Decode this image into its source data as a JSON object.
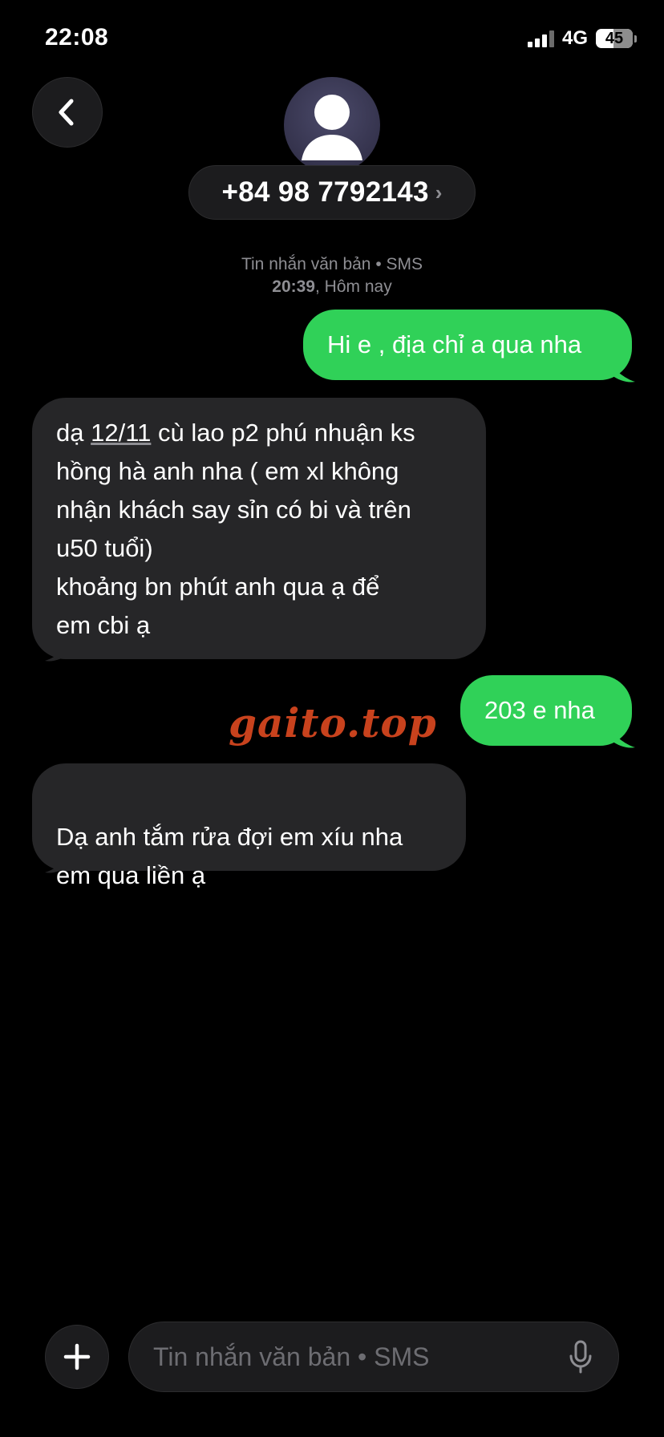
{
  "status_bar": {
    "time": "22:08",
    "network": "4G",
    "battery": "45"
  },
  "header": {
    "contact": "+84 98 7792143",
    "chevron": "›"
  },
  "thread": {
    "service_label": "Tin nhắn văn bản • SMS",
    "timestamp_time": "20:39",
    "timestamp_day": ", Hôm nay"
  },
  "messages": [
    {
      "direction": "outgoing",
      "text": "Hi e , địa chỉ a qua nha"
    },
    {
      "direction": "incoming",
      "text_before": "dạ ",
      "date_link": "12/11",
      "text_after": " cù lao p2 phú nhuận ks\nhồng hà anh nha  (  em xl không\nnhận khách say sỉn có bi và trên\nu50 tuổi)\nkhoảng bn phút anh qua ạ để\nem cbi ạ"
    },
    {
      "direction": "outgoing",
      "text": "203 e nha"
    },
    {
      "direction": "incoming",
      "text": "Dạ anh tắm rửa đợi em xíu nha\nem qua liền ạ"
    }
  ],
  "watermark": "gaito.top",
  "composer": {
    "placeholder": "Tin nhắn văn bản • SMS"
  },
  "colors": {
    "outgoing_bubble": "#30d158",
    "incoming_bubble": "#262628",
    "background": "#000000",
    "watermark": "#c8421d"
  },
  "icons": {
    "back": "chevron-left-icon",
    "avatar": "person-icon",
    "add": "plus-icon",
    "mic": "microphone-icon"
  }
}
